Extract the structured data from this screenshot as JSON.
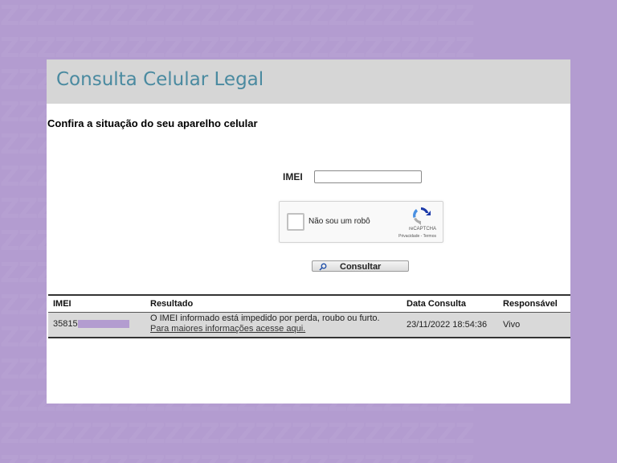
{
  "app": {
    "title": "Consulta Celular Legal",
    "subtitle": "Confira a situação do seu aparelho celular"
  },
  "form": {
    "imei_label": "IMEI",
    "imei_value": "",
    "captcha_label": "Não sou um robô",
    "captcha_brand": "reCAPTCHA",
    "captcha_links": "Privacidade - Termos",
    "submit_label": "Consultar"
  },
  "results": {
    "columns": [
      "IMEI",
      "Resultado",
      "Data Consulta",
      "Responsável"
    ],
    "rows": [
      {
        "imei": "35815",
        "result_text": "O IMEI informado está impedido por perda, roubo ou furto.",
        "result_link": "Para maiores informações acesse aqui.",
        "date": "23/11/2022 18:54:36",
        "responsible": "Vivo"
      }
    ]
  },
  "colors": {
    "background": "#b39cd0",
    "header": "#d6d6d6",
    "title": "#4a8aa0",
    "row": "#d9d9d9"
  },
  "icons": [
    "recaptcha-logo-icon",
    "search-icon"
  ]
}
